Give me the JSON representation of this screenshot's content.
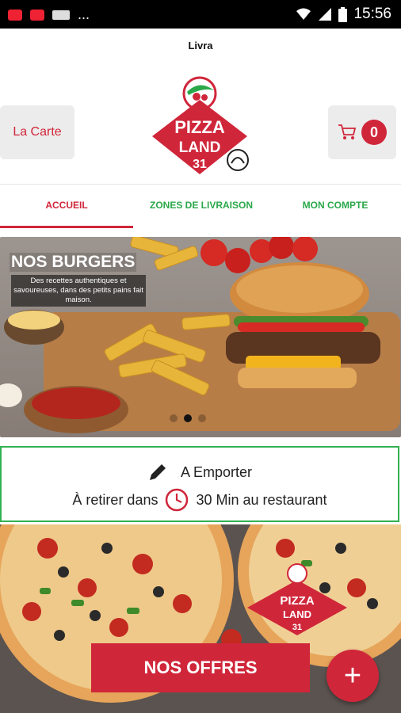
{
  "status_bar": {
    "time": "15:56",
    "dots": "..."
  },
  "header": {
    "title": "Livra",
    "carte_label": "La Carte",
    "cart_count": "0"
  },
  "logo": {
    "line1": "PIZZA",
    "line2": "LAND",
    "line3": "31"
  },
  "tabs": [
    {
      "label": "ACCUEIL",
      "active": true
    },
    {
      "label": "ZONES DE LIVRAISON",
      "active": false
    },
    {
      "label": "MON COMPTE",
      "active": false
    }
  ],
  "slider": {
    "title": "NOS BURGERS",
    "description": "Des recettes authentiques et savoureuses, dans des petits pains fait maison.",
    "active_index": 1,
    "count": 3
  },
  "emporter": {
    "title": "A Emporter",
    "retirer_prefix": "À retirer dans",
    "retirer_suffix": "30 Min au restaurant"
  },
  "banner": {
    "logo_line1": "PIZZA",
    "logo_line2": "LAND",
    "logo_line3": "31"
  },
  "actions": {
    "offres_label": "NOS OFFRES",
    "fab_label": "+"
  },
  "colors": {
    "brand_red": "#d0263a",
    "green": "#2aa84a",
    "border_green": "#32b152"
  }
}
